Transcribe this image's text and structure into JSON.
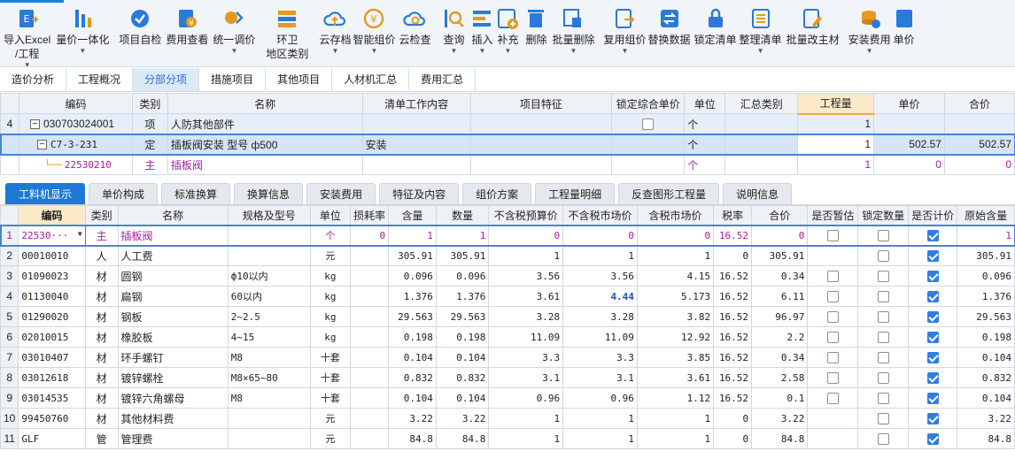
{
  "toolbar": [
    {
      "label": "导入Excel\n/工程",
      "icon": "import-excel-icon",
      "arrow": true,
      "color": "#2a7ad8"
    },
    {
      "label": "量价一体化",
      "icon": "price-integration-icon",
      "arrow": true,
      "color": "#2a7ad8"
    },
    {
      "label": "项目自检",
      "icon": "project-check-icon",
      "arrow": false,
      "color": "#2a7ad8"
    },
    {
      "label": "费用查看",
      "icon": "fee-view-icon",
      "arrow": false,
      "color": "#2a7ad8"
    },
    {
      "label": "统一调价",
      "icon": "unified-adjust-icon",
      "arrow": true,
      "color": "#e59a1e"
    },
    {
      "label": "环卫\n地区类别",
      "icon": "sanitation-region-icon",
      "arrow": false,
      "color": "#e59a1e"
    },
    {
      "label": "云存档",
      "icon": "cloud-archive-icon",
      "arrow": true,
      "color": "#2a7ad8"
    },
    {
      "label": "智能组价",
      "icon": "smart-pricing-icon",
      "arrow": true,
      "color": "#e59a1e"
    },
    {
      "label": "云检查",
      "icon": "cloud-check-icon",
      "arrow": false,
      "color": "#2a7ad8"
    },
    {
      "label": "查询",
      "icon": "query-icon",
      "arrow": true,
      "color": "#2a7ad8"
    },
    {
      "label": "插入",
      "icon": "insert-icon",
      "arrow": true,
      "color": "#2a7ad8"
    },
    {
      "label": "补充",
      "icon": "supplement-icon",
      "arrow": true,
      "color": "#2a7ad8"
    },
    {
      "label": "删除",
      "icon": "delete-icon",
      "arrow": false,
      "color": "#2a7ad8"
    },
    {
      "label": "批量删除",
      "icon": "batch-delete-icon",
      "arrow": true,
      "color": "#2a7ad8"
    },
    {
      "label": "复用组价",
      "icon": "reuse-pricing-icon",
      "arrow": true,
      "color": "#2a7ad8"
    },
    {
      "label": "替换数据",
      "icon": "replace-data-icon",
      "arrow": false,
      "color": "#2a7ad8"
    },
    {
      "label": "锁定清单",
      "icon": "lock-list-icon",
      "arrow": false,
      "color": "#2a7ad8"
    },
    {
      "label": "整理清单",
      "icon": "organize-list-icon",
      "arrow": true,
      "color": "#2a7ad8"
    },
    {
      "label": "批量改主材",
      "icon": "batch-edit-material-icon",
      "arrow": false,
      "color": "#2a7ad8"
    },
    {
      "label": "安装费用",
      "icon": "install-fee-icon",
      "arrow": true,
      "color": "#e59a1e"
    },
    {
      "label": "单价",
      "icon": "unit-price-icon",
      "arrow": false,
      "color": "#2a7ad8"
    }
  ],
  "nav_tabs": [
    {
      "label": "造价分析",
      "active": false
    },
    {
      "label": "工程概况",
      "active": false
    },
    {
      "label": "分部分项",
      "active": true
    },
    {
      "label": "措施项目",
      "active": false
    },
    {
      "label": "其他项目",
      "active": false
    },
    {
      "label": "人材机汇总",
      "active": false
    },
    {
      "label": "费用汇总",
      "active": false
    }
  ],
  "top_grid": {
    "headers": [
      "",
      "编码",
      "类别",
      "名称",
      "清单工作内容",
      "项目特征",
      "锁定综合单价",
      "单位",
      "汇总类别",
      "工程量",
      "单价",
      "合价"
    ],
    "rows": [
      {
        "num": "4",
        "code": "030703024001",
        "type": "项",
        "name": "人防其他部件",
        "work": "",
        "feature": "",
        "lock": false,
        "unit": "个",
        "sum_cat": "",
        "qty": "1",
        "price": "",
        "total": ""
      },
      {
        "num": "",
        "code": "C7-3-231",
        "type": "定",
        "name": "插板阀安装 型号 ф500",
        "work": "安装",
        "feature": "",
        "lock": null,
        "unit": "个",
        "sum_cat": "",
        "qty": "1",
        "price": "502.57",
        "total": "502.57"
      },
      {
        "num": "",
        "code": "22530210",
        "type": "主",
        "name": "插板阀",
        "work": "",
        "feature": "",
        "lock": null,
        "unit": "个",
        "sum_cat": "",
        "qty": "1",
        "price": "0",
        "total": "0"
      }
    ]
  },
  "sub_tabs": [
    {
      "label": "工料机显示",
      "active": true
    },
    {
      "label": "单价构成",
      "active": false
    },
    {
      "label": "标准换算",
      "active": false
    },
    {
      "label": "换算信息",
      "active": false
    },
    {
      "label": "安装费用",
      "active": false
    },
    {
      "label": "特征及内容",
      "active": false
    },
    {
      "label": "组价方案",
      "active": false
    },
    {
      "label": "工程量明细",
      "active": false
    },
    {
      "label": "反查图形工程量",
      "active": false
    },
    {
      "label": "说明信息",
      "active": false
    }
  ],
  "bottom_grid": {
    "headers": [
      "",
      "编码",
      "类别",
      "名称",
      "规格及型号",
      "单位",
      "损耗率",
      "含量",
      "数量",
      "不含税预算价",
      "不含税市场价",
      "含税市场价",
      "税率",
      "合价",
      "是否暂估",
      "锁定数量",
      "是否计价",
      "原始含量"
    ],
    "rows": [
      {
        "num": "1",
        "code": "22530···",
        "type": "主",
        "name": "插板阀",
        "spec": "",
        "unit": "个",
        "loss": "0",
        "content": "1",
        "qty": "1",
        "pre_budget": "0",
        "pre_market": "0",
        "tax_market": "0",
        "tax": "16.52",
        "total": "0",
        "zangu": false,
        "lockqty": false,
        "priced": true,
        "orig": "1"
      },
      {
        "num": "2",
        "code": "00010010",
        "type": "人",
        "name": "人工费",
        "spec": "",
        "unit": "元",
        "loss": "",
        "content": "305.91",
        "qty": "305.91",
        "pre_budget": "1",
        "pre_market": "1",
        "tax_market": "1",
        "tax": "0",
        "total": "305.91",
        "zangu": null,
        "lockqty": false,
        "priced": true,
        "orig": "305.91"
      },
      {
        "num": "3",
        "code": "01090023",
        "type": "材",
        "name": "圆钢",
        "spec": "ф10以内",
        "unit": "kg",
        "loss": "",
        "content": "0.096",
        "qty": "0.096",
        "pre_budget": "3.56",
        "pre_market": "3.56",
        "tax_market": "4.15",
        "tax": "16.52",
        "total": "0.34",
        "zangu": false,
        "lockqty": false,
        "priced": true,
        "orig": "0.096"
      },
      {
        "num": "4",
        "code": "01130040",
        "type": "材",
        "name": "扁钢",
        "spec": "60以内",
        "unit": "kg",
        "loss": "",
        "content": "1.376",
        "qty": "1.376",
        "pre_budget": "3.61",
        "pre_market": "4.44",
        "tax_market": "5.173",
        "tax": "16.52",
        "total": "6.11",
        "zangu": false,
        "lockqty": false,
        "priced": true,
        "orig": "1.376",
        "highlight_market": true
      },
      {
        "num": "5",
        "code": "01290020",
        "type": "材",
        "name": "钢板",
        "spec": "2~2.5",
        "unit": "kg",
        "loss": "",
        "content": "29.563",
        "qty": "29.563",
        "pre_budget": "3.28",
        "pre_market": "3.28",
        "tax_market": "3.82",
        "tax": "16.52",
        "total": "96.97",
        "zangu": false,
        "lockqty": false,
        "priced": true,
        "orig": "29.563"
      },
      {
        "num": "6",
        "code": "02010015",
        "type": "材",
        "name": "橡胶板",
        "spec": "4~15",
        "unit": "kg",
        "loss": "",
        "content": "0.198",
        "qty": "0.198",
        "pre_budget": "11.09",
        "pre_market": "11.09",
        "tax_market": "12.92",
        "tax": "16.52",
        "total": "2.2",
        "zangu": false,
        "lockqty": false,
        "priced": true,
        "orig": "0.198"
      },
      {
        "num": "7",
        "code": "03010407",
        "type": "材",
        "name": "环手螺钉",
        "spec": "M8",
        "unit": "十套",
        "loss": "",
        "content": "0.104",
        "qty": "0.104",
        "pre_budget": "3.3",
        "pre_market": "3.3",
        "tax_market": "3.85",
        "tax": "16.52",
        "total": "0.34",
        "zangu": false,
        "lockqty": false,
        "priced": true,
        "orig": "0.104"
      },
      {
        "num": "8",
        "code": "03012618",
        "type": "材",
        "name": "镀锌螺栓",
        "spec": "M8×65~80",
        "unit": "十套",
        "loss": "",
        "content": "0.832",
        "qty": "0.832",
        "pre_budget": "3.1",
        "pre_market": "3.1",
        "tax_market": "3.61",
        "tax": "16.52",
        "total": "2.58",
        "zangu": false,
        "lockqty": false,
        "priced": true,
        "orig": "0.832"
      },
      {
        "num": "9",
        "code": "03014535",
        "type": "材",
        "name": "镀锌六角螺母",
        "spec": "M8",
        "unit": "十套",
        "loss": "",
        "content": "0.104",
        "qty": "0.104",
        "pre_budget": "0.96",
        "pre_market": "0.96",
        "tax_market": "1.12",
        "tax": "16.52",
        "total": "0.1",
        "zangu": false,
        "lockqty": false,
        "priced": true,
        "orig": "0.104"
      },
      {
        "num": "10",
        "code": "99450760",
        "type": "材",
        "name": "其他材料费",
        "spec": "",
        "unit": "元",
        "loss": "",
        "content": "3.22",
        "qty": "3.22",
        "pre_budget": "1",
        "pre_market": "1",
        "tax_market": "1",
        "tax": "0",
        "total": "3.22",
        "zangu": null,
        "lockqty": false,
        "priced": true,
        "orig": "3.22"
      },
      {
        "num": "11",
        "code": "GLF",
        "type": "管",
        "name": "管理费",
        "spec": "",
        "unit": "元",
        "loss": "",
        "content": "84.8",
        "qty": "84.8",
        "pre_budget": "1",
        "pre_market": "1",
        "tax_market": "1",
        "tax": "0",
        "total": "84.8",
        "zangu": null,
        "lockqty": false,
        "priced": true,
        "orig": "84.8"
      }
    ]
  }
}
